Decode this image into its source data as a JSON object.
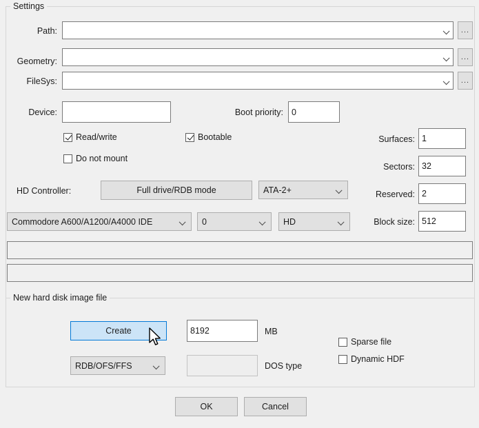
{
  "settings": {
    "group_title": "Settings",
    "fields": {
      "path_label": "Path:",
      "path_value": "",
      "geometry_label": "Geometry:",
      "geometry_value": "",
      "filesys_label": "FileSys:",
      "filesys_value": "",
      "device_label": "Device:",
      "device_value": "",
      "boot_priority_label": "Boot priority:",
      "boot_priority_value": "0"
    },
    "browse_button_label": "...",
    "checkboxes": {
      "readwrite_label": "Read/write",
      "readwrite_checked": true,
      "bootable_label": "Bootable",
      "bootable_checked": true,
      "donotmount_label": "Do not mount",
      "donotmount_checked": false
    },
    "controller": {
      "label": "HD Controller:",
      "mode_button_label": "Full drive/RDB mode",
      "ata_value": "ATA-2+",
      "controller_value": "Commodore A600/A1200/A4000 IDE",
      "unit_value": "0",
      "type_value": "HD"
    },
    "geometry_right": {
      "surfaces_label": "Surfaces:",
      "surfaces_value": "1",
      "sectors_label": "Sectors:",
      "sectors_value": "32",
      "reserved_label": "Reserved:",
      "reserved_value": "2",
      "blocksize_label": "Block size:",
      "blocksize_value": "512"
    },
    "info_bar_1": "",
    "info_bar_2": ""
  },
  "new_image": {
    "group_title": "New hard disk image file",
    "create_button_label": "Create",
    "size_value": "8192",
    "size_unit_label": "MB",
    "filesystem_value": "RDB/OFS/FFS",
    "dostype_value": "",
    "dostype_label": "DOS type",
    "sparse_label": "Sparse file",
    "sparse_checked": false,
    "dynamic_label": "Dynamic HDF",
    "dynamic_checked": false
  },
  "dialog_buttons": {
    "ok_label": "OK",
    "cancel_label": "Cancel"
  },
  "colors": {
    "window_bg": "#f0f0f0",
    "hover_accent": "#cce4f7",
    "hover_border": "#0078d7",
    "field_border": "#7a7a7a",
    "control_bg": "#e1e1e1"
  }
}
